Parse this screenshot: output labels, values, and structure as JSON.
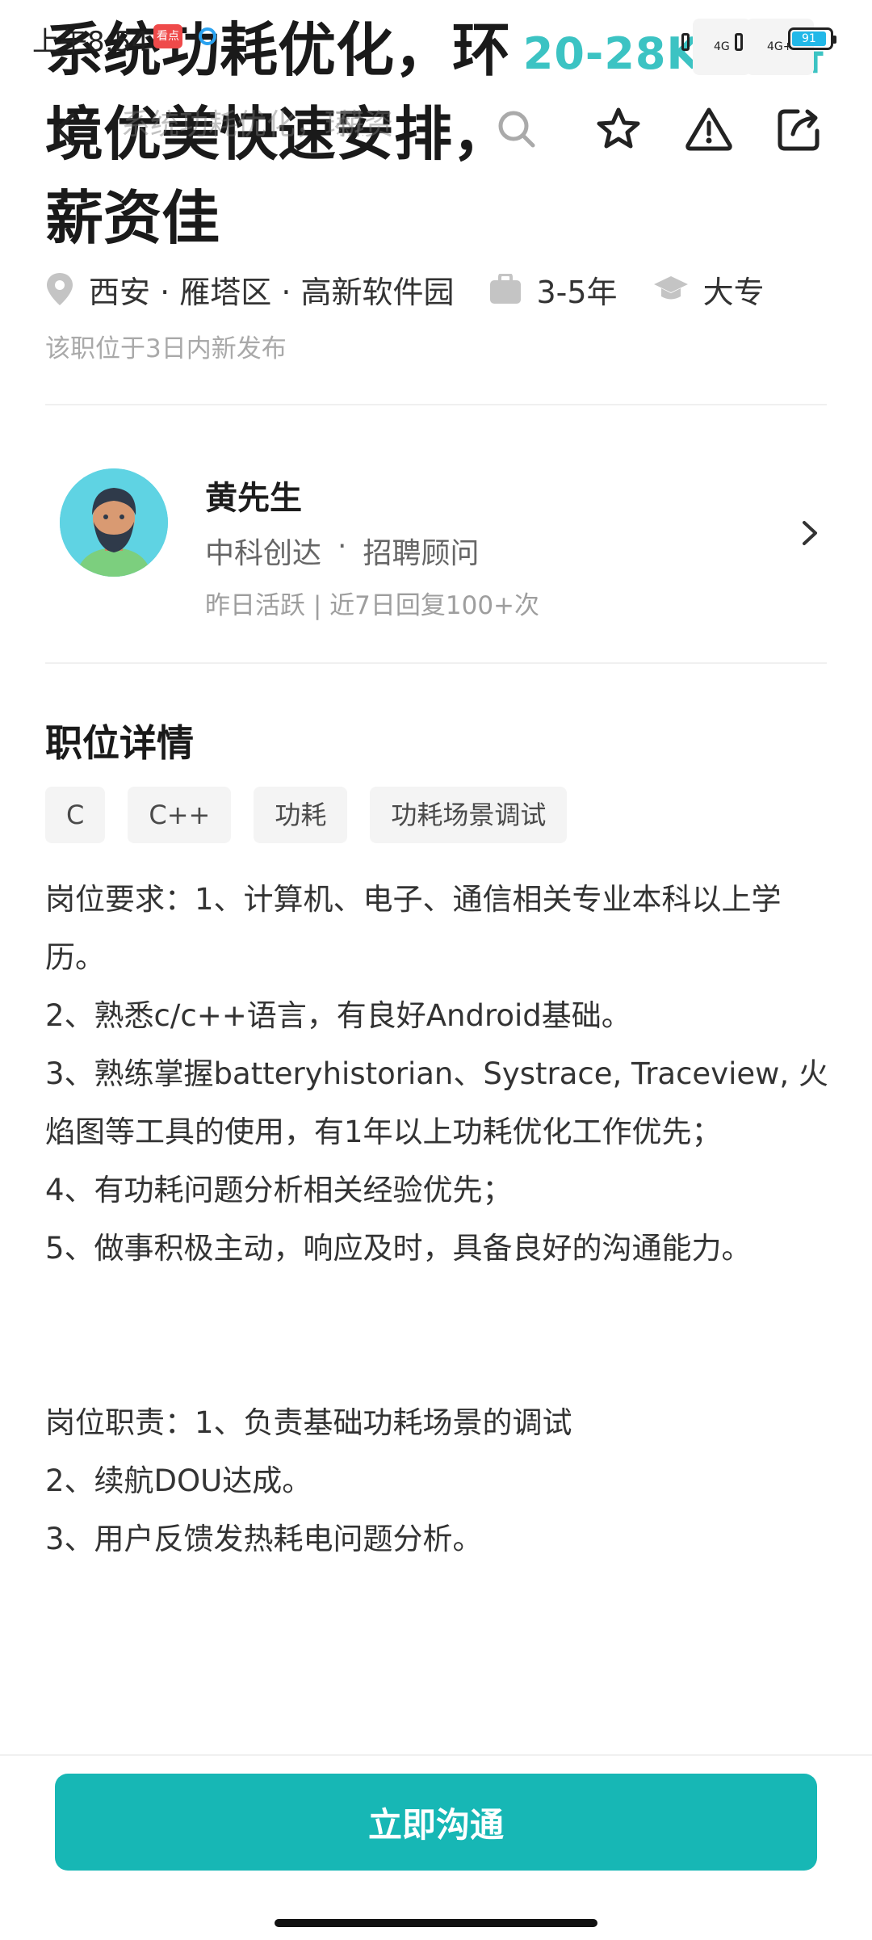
{
  "status_bar": {
    "time": "上午8:54",
    "app_badge": "看点",
    "network_1": "4G",
    "network_2": "4G+",
    "battery": "91"
  },
  "nav": {
    "collapsed_title": "系统功耗优化，环境",
    "collapsed_salary": "薪资",
    "icons": [
      "back-icon",
      "search-icon",
      "star-icon",
      "warning-icon",
      "share-icon"
    ]
  },
  "job": {
    "title": "系统功耗优化，环境优美快速安排，薪资佳",
    "salary": "20-28K·13薪",
    "location": "西安 · 雁塔区 · 高新软件园",
    "experience": "3-5年",
    "education": "大专",
    "posted": "该职位于3日内新发布"
  },
  "recruiter": {
    "name": "黄先生",
    "company": "中科创达",
    "separator": "·",
    "role": "招聘顾问",
    "activity": "昨日活跃 | 近7日回复100+次"
  },
  "details": {
    "section_title": "职位详情",
    "tags": [
      "C",
      "C++",
      "功耗",
      "功耗场景调试"
    ],
    "requirements": [
      "岗位要求：1、计算机、电子、通信相关专业本科以上学历。",
      "2、熟悉c/c++语言，有良好Android基础。",
      "3、熟练掌握batteryhistorian、Systrace, Traceview, 火焰图等工具的使用，有1年以上功耗优化工作优先；",
      "4、有功耗问题分析相关经验优先；",
      "5、做事积极主动，响应及时，具备良好的沟通能力。"
    ],
    "responsibilities": [
      "岗位职责：1、负责基础功耗场景的调试",
      "2、续航DOU达成。",
      "3、用户反馈发热耗电问题分析。"
    ]
  },
  "cta": {
    "label": "立即沟通"
  },
  "colors": {
    "accent": "#17b7b5",
    "salary": "#3cc3c3"
  }
}
